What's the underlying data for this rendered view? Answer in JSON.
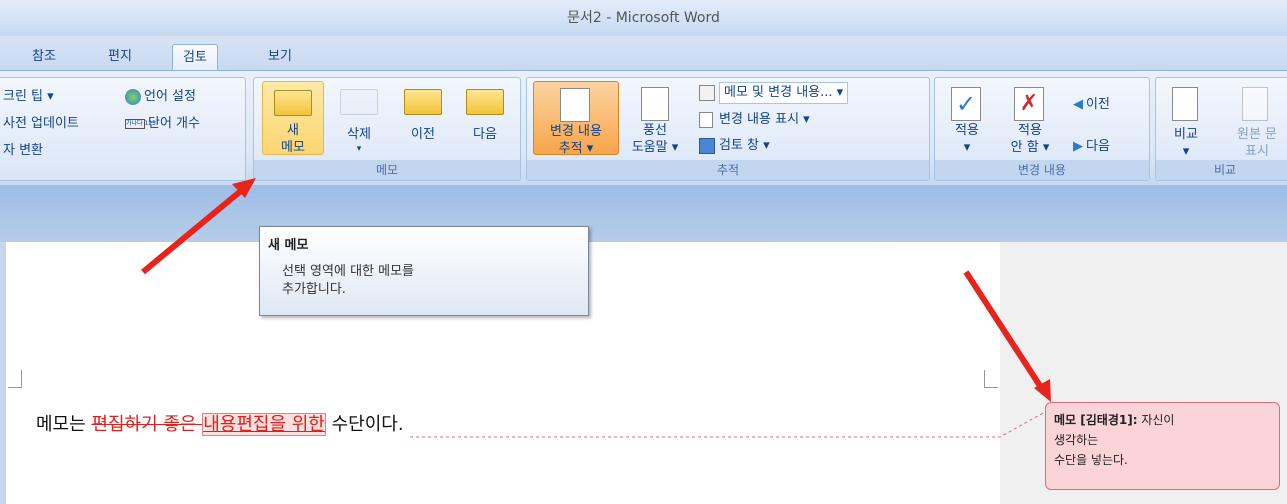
{
  "window": {
    "title": "문서2 - Microsoft Word"
  },
  "tabs": [
    {
      "label": "참조"
    },
    {
      "label": "편지"
    },
    {
      "label": "검토"
    },
    {
      "label": "보기"
    }
  ],
  "ribbon": {
    "proofing": {
      "items": [
        "크린 팁 ▾",
        "사전 업데이트",
        "자 변환",
        "언어 설정",
        "단어 개수"
      ],
      "word_count_icon_text": "가나다 123"
    },
    "memo": {
      "new_label": "새\n메모",
      "delete_label": "삭제",
      "delete_arrow": "▾",
      "prev_label": "이전",
      "next_label": "다음",
      "group_label": "메모"
    },
    "tracking": {
      "track_label": "변경 내용\n추적 ▾",
      "balloon_label": "풍선\n도움말 ▾",
      "markup_dropdown": "메모 및 변경 내용... ▾",
      "show_changes": "변경 내용 표시 ▾",
      "review_pane": "검토 창 ▾",
      "group_label": "추적"
    },
    "changes": {
      "accept_label": "적용\n▾",
      "reject_label": "적용\n안 함 ▾",
      "prev_label": "이전",
      "next_label": "다음",
      "group_label": "변경 내용"
    },
    "compare": {
      "compare_label": "비교\n▾",
      "show_source_label": "원본 문\n표시",
      "group_label": "비교"
    }
  },
  "tooltip": {
    "title": "새 메모",
    "body": "선택 영역에 대한 메모를\n추가합니다."
  },
  "document": {
    "text_before": "메모는 ",
    "deleted": "편집하기 좋은 ",
    "inserted": "내용편집을 위한",
    "text_after": " 수단이다."
  },
  "comment": {
    "label": "메모 [김태경1]:",
    "text": " 자신이\n생각하는\n수단을 넣는다."
  },
  "colors": {
    "arrow": "#e8231c",
    "ribbon_highlight": "#fbd671",
    "comment_bg": "#fbd4d8"
  }
}
